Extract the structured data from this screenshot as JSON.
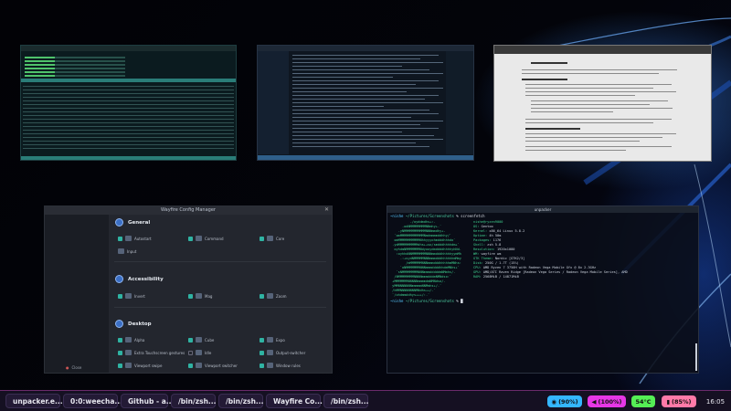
{
  "colors": {
    "taskbar_bg": "#151022",
    "wifi_pill": "#34b6ff",
    "volume_pill": "#e637e6",
    "temp_pill": "#55ee55",
    "battery_pill": "#ff7aa8"
  },
  "config_manager": {
    "title": "Wayfire Config Manager",
    "close_label": "Close",
    "categories": [
      {
        "name": "General",
        "plugins": [
          {
            "label": "Autostart",
            "enabled": true
          },
          {
            "label": "Command",
            "enabled": true
          },
          {
            "label": "Core",
            "enabled": true
          },
          {
            "label": "Input",
            "enabled": true
          }
        ]
      },
      {
        "name": "Accessibility",
        "plugins": [
          {
            "label": "Invert",
            "enabled": true
          },
          {
            "label": "Mag",
            "enabled": true
          },
          {
            "label": "Zoom",
            "enabled": true
          }
        ]
      },
      {
        "name": "Desktop",
        "plugins": [
          {
            "label": "Alpha",
            "enabled": true
          },
          {
            "label": "Cube",
            "enabled": true
          },
          {
            "label": "Expo",
            "enabled": true
          },
          {
            "label": "Extra Touchscreen gestures",
            "enabled": true
          },
          {
            "label": "Idle",
            "enabled": false
          },
          {
            "label": "Output-switcher",
            "enabled": true
          },
          {
            "label": "Viewport swipe",
            "enabled": true
          },
          {
            "label": "Viewport switcher",
            "enabled": true
          },
          {
            "label": "Window rules",
            "enabled": true
          }
        ]
      }
    ]
  },
  "terminal": {
    "title": "unpacker",
    "prompt_user": "~nishe",
    "prompt_path": "~/Pictures/Screenshots",
    "command": "screenfetch",
    "info_header": "nishe@ryzen9000",
    "info": [
      {
        "key": "OS:",
        "value": "Gentoo"
      },
      {
        "key": "Kernel:",
        "value": "x86_64 Linux 5.8.2"
      },
      {
        "key": "Uptime:",
        "value": "4h 50m"
      },
      {
        "key": "Packages:",
        "value": "1176"
      },
      {
        "key": "Shell:",
        "value": "zsh 5.8"
      },
      {
        "key": "Resolution:",
        "value": "1920x1080"
      },
      {
        "key": "WM:",
        "value": "wayfire wm"
      },
      {
        "key": "GTK Theme:",
        "value": "Nordic [GTK2/3]"
      },
      {
        "key": "Disk:",
        "value": "250G / 1.7T (15%)"
      },
      {
        "key": "CPU:",
        "value": "AMD Ryzen 7 3750H with Radeon Vega Mobile Gfx @ 8x 2.3GHz"
      },
      {
        "key": "GPU:",
        "value": "AMD/ATI Raven Ridge [Radeon Vega Series / Radeon Vega Mobile Series], AMD"
      },
      {
        "key": "RAM:",
        "value": "2568MiB / 14871MiB"
      }
    ]
  },
  "taskbar": {
    "tasks": [
      {
        "label": "unpacker.e...",
        "icon_color": "#e25555"
      },
      {
        "label": "0:0:weecha...",
        "icon_color": "#e27a2b"
      },
      {
        "label": "Github - a...",
        "icon_color": "#4a90e2"
      },
      {
        "label": "/bin/zsh...",
        "icon_color": "#e27a2b"
      },
      {
        "label": "/bin/zsh...",
        "icon_color": "#e27a2b"
      },
      {
        "label": "Wayfire Co...",
        "icon_color": "#e2a02b"
      },
      {
        "label": "/bin/zsh...",
        "icon_color": "#e27a2b"
      }
    ],
    "wifi": "(90%)",
    "volume": "(100%)",
    "temperature": "54°C",
    "battery": "(85%)",
    "clock": "16:05"
  }
}
